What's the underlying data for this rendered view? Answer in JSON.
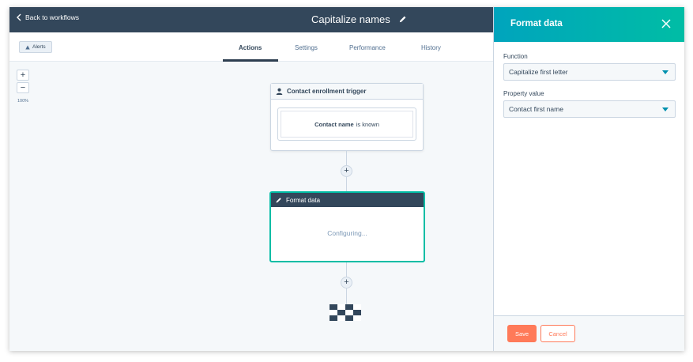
{
  "topbar": {
    "back_label": "Back to workflows",
    "workflow_title": "Capitalize names"
  },
  "toolbar": {
    "alerts_label": "Alerts"
  },
  "tabs": [
    {
      "label": "Actions",
      "active": true
    },
    {
      "label": "Settings",
      "active": false
    },
    {
      "label": "Performance",
      "active": false
    },
    {
      "label": "History",
      "active": false
    }
  ],
  "zoom": {
    "plus": "+",
    "minus": "−",
    "level": "100%"
  },
  "canvas": {
    "trigger": {
      "title": "Contact enrollment trigger",
      "condition_property": "Contact name",
      "condition_operator": "is known"
    },
    "action": {
      "title": "Format data",
      "status": "Configuring..."
    },
    "add_symbol": "+"
  },
  "panel": {
    "title": "Format data",
    "function_label": "Function",
    "function_value": "Capitalize first letter",
    "property_label": "Property value",
    "property_value": "Contact first name",
    "save_label": "Save",
    "cancel_label": "Cancel"
  },
  "colors": {
    "topbar": "#33475b",
    "accent_teal": "#00bda5",
    "accent_orange": "#ff7a59"
  }
}
